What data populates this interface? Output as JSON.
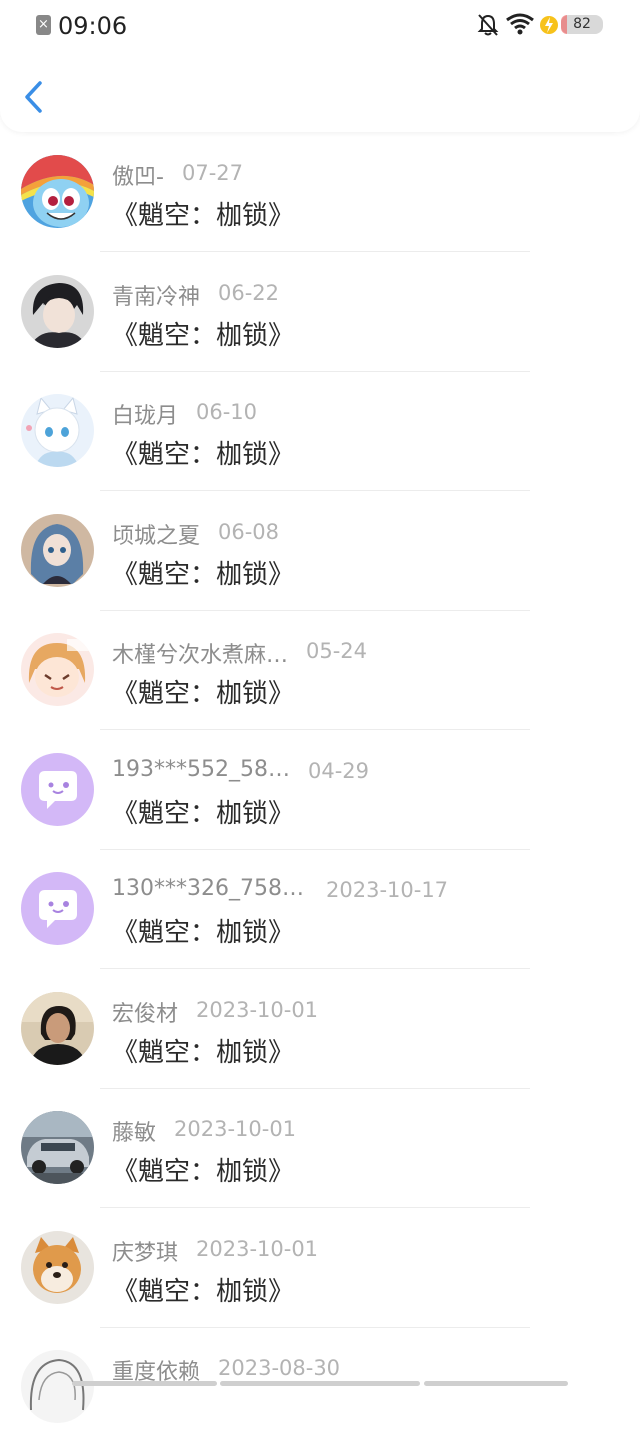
{
  "status_bar": {
    "time": "09:06",
    "battery": "82"
  },
  "header": {
    "back_icon": "chevron-left-icon",
    "accent": "#3a8ee6"
  },
  "items": [
    {
      "name": "傲凹-",
      "date": "07-27",
      "title": "《魈空：枷锁》",
      "avatar": "rainbow-pony"
    },
    {
      "name": "青南冷神",
      "date": "06-22",
      "title": "《魈空：枷锁》",
      "avatar": "dark-hair-boy"
    },
    {
      "name": "白珑月",
      "date": "06-10",
      "title": "《魈空：枷锁》",
      "avatar": "white-cat-girl"
    },
    {
      "name": "顷城之夏",
      "date": "06-08",
      "title": "《魈空：枷锁》",
      "avatar": "blue-hair-girl"
    },
    {
      "name": "木槿兮次水煮麻…",
      "date": "05-24",
      "title": "《魈空：枷锁》",
      "avatar": "chibi-girl"
    },
    {
      "name": "193***552_58…",
      "date": "04-29",
      "title": "《魈空：枷锁》",
      "avatar": "default-chat"
    },
    {
      "name": "130***326_758…",
      "date": "2023-10-17",
      "title": "《魈空：枷锁》",
      "avatar": "default-chat"
    },
    {
      "name": "宏俊材",
      "date": "2023-10-01",
      "title": "《魈空：枷锁》",
      "avatar": "woman-photo"
    },
    {
      "name": "藤敏",
      "date": "2023-10-01",
      "title": "《魈空：枷锁》",
      "avatar": "car-photo"
    },
    {
      "name": "庆梦琪",
      "date": "2023-10-01",
      "title": "《魈空：枷锁》",
      "avatar": "shiba-dog"
    },
    {
      "name": "重度依赖",
      "date": "2023-08-30",
      "title": "",
      "avatar": "sketch-girl"
    }
  ]
}
